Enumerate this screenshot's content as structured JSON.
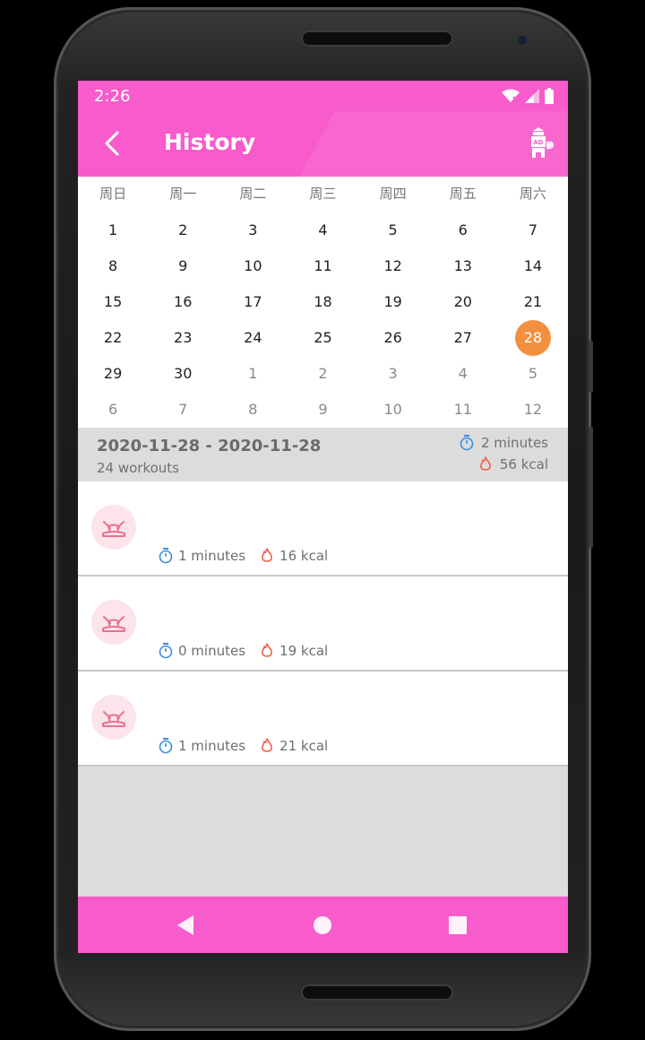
{
  "status": {
    "time": "2:26"
  },
  "appbar": {
    "title": "History"
  },
  "calendar": {
    "weekdays": [
      "周日",
      "周一",
      "周二",
      "周三",
      "周四",
      "周五",
      "周六"
    ],
    "rows": [
      [
        "1",
        "2",
        "3",
        "4",
        "5",
        "6",
        "7"
      ],
      [
        "8",
        "9",
        "10",
        "11",
        "12",
        "13",
        "14"
      ],
      [
        "15",
        "16",
        "17",
        "18",
        "19",
        "20",
        "21"
      ],
      [
        "22",
        "23",
        "24",
        "25",
        "26",
        "27",
        "28"
      ],
      [
        "29",
        "30",
        "1",
        "2",
        "3",
        "4",
        "5"
      ],
      [
        "6",
        "7",
        "8",
        "9",
        "10",
        "11",
        "12"
      ]
    ],
    "selected_day": "28"
  },
  "summary": {
    "date_range": "2020-11-28 - 2020-11-28",
    "workouts": "24 workouts",
    "duration": "2 minutes",
    "calories": "56 kcal"
  },
  "workouts": [
    {
      "duration": "1 minutes",
      "calories": "16 kcal"
    },
    {
      "duration": "0 minutes",
      "calories": "19 kcal"
    },
    {
      "duration": "1 minutes",
      "calories": "21 kcal"
    }
  ],
  "colors": {
    "accent": "#f85bcb",
    "selected": "#f39040",
    "timer": "#3d8ee0",
    "flame": "#ef5f48"
  },
  "icons": {
    "back": "chevron-left-icon",
    "ad": "ad-tower-icon",
    "timer": "stopwatch-icon",
    "flame": "flame-icon",
    "workout": "workout-figure-icon"
  }
}
